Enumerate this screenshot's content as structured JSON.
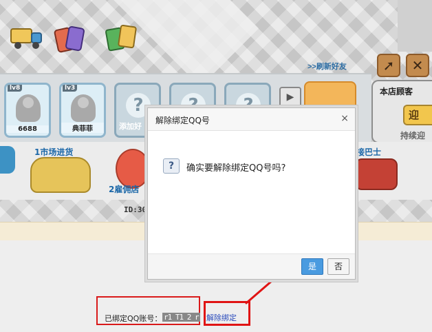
{
  "game": {
    "refresh_friends": ">>刷新好友",
    "friends": [
      {
        "level": "lv8",
        "name": "6688"
      },
      {
        "level": "lv3",
        "name": "典菲菲"
      }
    ],
    "add_friend": "添加好",
    "shop_customers": "本店顾客",
    "welcome": "迎",
    "continue": "持续迎",
    "mission_market": "1市场进货",
    "mission_hire": "2雇佣店",
    "bus_pickup": "接巴士",
    "id_label": "ID:30"
  },
  "dialog": {
    "title": "解除绑定QQ号",
    "close": "×",
    "question_icon": "?",
    "message": "确实要解除绑定QQ号吗?",
    "yes": "是",
    "no": "否"
  },
  "binding": {
    "label": "已绑定QQ账号：",
    "value": "r1 T1 2 r"
  },
  "unbind": {
    "link": "解除绑定"
  },
  "colors": {
    "accent_red": "#e01414",
    "yes_button": "#4a9be0",
    "link_blue": "#2a4bbb"
  }
}
